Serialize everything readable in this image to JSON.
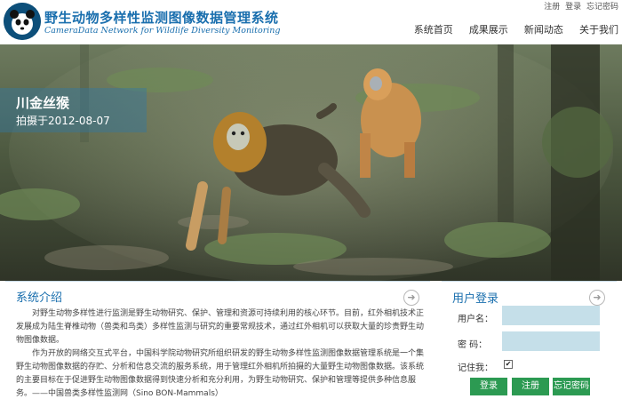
{
  "header": {
    "title_cn": "野生动物多样性监测图像数据管理系统",
    "title_en": "CameraData Network for Wildlife Diversity Monitoring",
    "top_links": [
      "注册",
      "登录",
      "忘记密码"
    ],
    "nav": [
      "系统首页",
      "成果展示",
      "新闻动态",
      "关于我们"
    ]
  },
  "hero": {
    "caption_title": "川金丝猴",
    "caption_date": "拍摄于2012-08-07"
  },
  "intro": {
    "title": "系统介绍",
    "more_icon": "circle-arrow-right",
    "paragraph1": "对野生动物多样性进行监测是野生动物研究、保护、管理和资源可持续利用的核心环节。目前，红外相机技术正发展成为陆生脊椎动物（兽类和鸟类）多样性监测与研究的重要常规技术，通过红外相机可以获取大量的珍贵野生动物图像数据。",
    "paragraph2": "作为开放的网络交互式平台，中国科学院动物研究所组织研发的野生动物多样性监测图像数据管理系统是一个集野生动物图像数据的存贮、分析和信息交流的服务系统，用于管理红外相机所拍摄的大量野生动物图像数据。该系统的主要目标在于促进野生动物图像数据得到快速分析和充分利用，为野生动物研究、保护和管理等提供多种信息服务。——中国兽类多样性监测网（Sino BON-Mammals）"
  },
  "login": {
    "title": "用户登录",
    "more_icon": "circle-arrow-right",
    "username_label": "用户名：",
    "password_label": "密  码：",
    "remember_label": "记住我：",
    "remember_checked": true,
    "login_button": "登录",
    "register_button": "注册",
    "forgot_button": "忘记密码"
  },
  "colors": {
    "brand_blue": "#1a6fae",
    "button_green": "#2c9a52",
    "input_bg": "#c5dfe9"
  }
}
